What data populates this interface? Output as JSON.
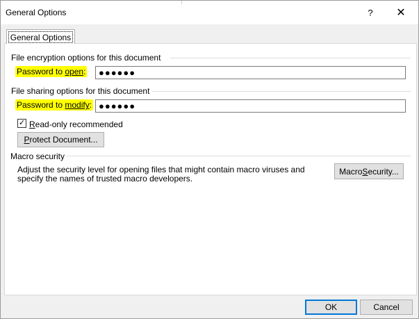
{
  "window": {
    "title": "General Options",
    "help_glyph": "?",
    "close_glyph": "✕"
  },
  "tab": {
    "label": "General Options"
  },
  "encryption": {
    "section_title": "File encryption options for this document",
    "label_prefix": "Password to ",
    "label_underlined": "open",
    "label_suffix": ":",
    "value": "●●●●●●"
  },
  "sharing": {
    "section_title": "File sharing options for this document",
    "label_prefix": "Password to ",
    "label_underlined": "modify",
    "label_suffix": ":",
    "value": "●●●●●●",
    "readonly_checked": true,
    "readonly_check_glyph": "✓",
    "readonly_underlined": "R",
    "readonly_rest": "ead-only recommended",
    "protect_underlined": "P",
    "protect_rest": "rotect Document..."
  },
  "macro": {
    "section_title": "Macro security",
    "description": "Adjust the security level for opening files that might contain macro viruses and specify the names of trusted macro developers.",
    "button_prefix": "Macro ",
    "button_underlined": "S",
    "button_suffix": "ecurity..."
  },
  "footer": {
    "ok_label": "OK",
    "cancel_label": "Cancel"
  },
  "colors": {
    "highlight": "#ffff00",
    "default_button_border": "#0078d7"
  }
}
